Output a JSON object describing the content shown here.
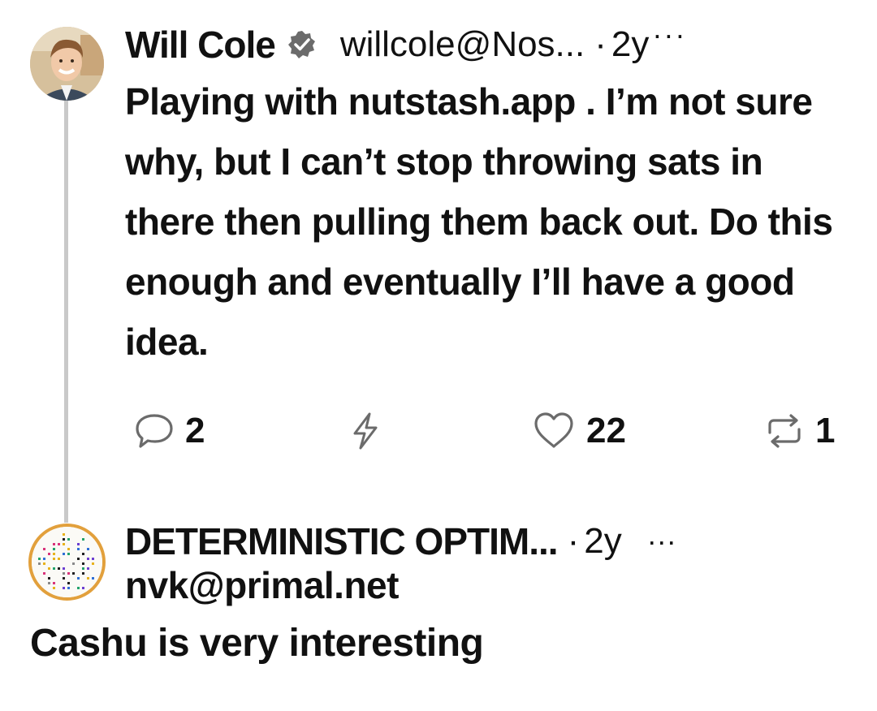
{
  "post": {
    "author_name": "Will Cole",
    "handle": "willcole@Nos...",
    "separator": "·",
    "time": "2y",
    "more": "···",
    "text": "Playing with nutstash.app . I’m not sure why, but I can’t stop throwing sats in there then pulling them back out. Do this enough and eventually I’ll have a good idea.",
    "actions": {
      "replies": "2",
      "likes": "22",
      "reposts": "1"
    }
  },
  "reply": {
    "author_name": "DETERMINISTIC OPTIM...",
    "separator": "·",
    "time": "2y",
    "more": "...",
    "handle": "nvk@primal.net",
    "text": "Cashu is very interesting"
  },
  "colors": {
    "thread_line": "#c9c9c9",
    "icon_gray": "#6b6b6b",
    "avatar_ring": "#e2a03c"
  },
  "icons": {
    "reply": "chat-bubble-icon",
    "zap": "lightning-bolt-icon",
    "like": "heart-icon",
    "repost": "repost-arrows-icon",
    "verified": "verified-badge-icon"
  }
}
